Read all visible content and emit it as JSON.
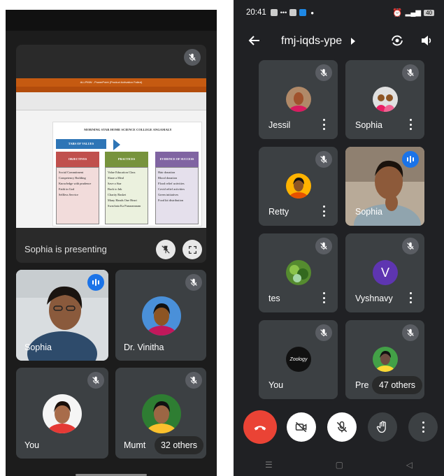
{
  "left_screen": {
    "presentation": {
      "ppt_title": "ALLPMW - PowerPoint (Product Activation Failed)",
      "college_title": "MORNING STAR HOME SCIENCE COLLEGE ANGAMALY",
      "tabs_label": "TABS OF VALUES",
      "columns": [
        {
          "heading": "OBJECTIVES",
          "items": [
            "Social Commitment",
            "Competency Building",
            "Knowledge with prudence",
            "Faith in God",
            "Selfless Service"
          ]
        },
        {
          "heading": "PRACTICES",
          "items": [
            "Value Education Class",
            "Share a Meal",
            "Save a Star",
            "Back to Ink",
            "Charity Basket",
            "Many Hands One Heart",
            "Swachata Ka Punaramnam"
          ]
        },
        {
          "heading": "EVIDENCE OF SUCCESS",
          "items": [
            "Hair donation",
            "Blood donation",
            "Flood relief activities",
            "Covid relief activities",
            "Green initiatives",
            "Food kit distribution"
          ]
        }
      ],
      "presenting_label": "Sophia is presenting"
    },
    "tiles": [
      {
        "name": "Sophia"
      },
      {
        "name": "Dr. Vinitha"
      },
      {
        "name": "You"
      },
      {
        "name": "Mumt"
      }
    ],
    "others_label": "32 others"
  },
  "right_screen": {
    "status": {
      "time": "20:41",
      "battery": "40"
    },
    "meeting_code": "fmj-iqds-ype",
    "tiles": [
      {
        "name": "Jessil"
      },
      {
        "name": "Sophia"
      },
      {
        "name": "Retty"
      },
      {
        "name": "Sophia"
      },
      {
        "name": "tes"
      },
      {
        "name": "Vyshnavy",
        "initial": "V"
      },
      {
        "name": "You",
        "avatar_text": "Zoology"
      },
      {
        "name": "Pre"
      }
    ],
    "others_label": "47 others"
  },
  "colors": {
    "end_call": "#ea4335",
    "speaking": "#1a73e8",
    "tile": "#3c4043",
    "vyshnavy_avatar": "#5e35b1"
  }
}
